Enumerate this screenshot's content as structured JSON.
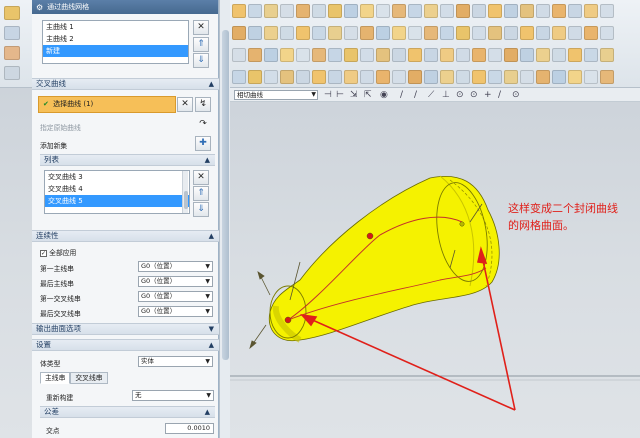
{
  "dialog": {
    "title": "通过曲线网格",
    "primary_curves": {
      "items": [
        "主曲线 1",
        "主曲线 2",
        "新建"
      ],
      "selected_index": 2
    },
    "cross_curves": {
      "header": "交叉曲线",
      "select_label": "选择曲线 (1)",
      "specify_origin": "指定原始曲线",
      "add_new_set": "添加新集",
      "list_header": "列表",
      "items": [
        "交叉曲线 3",
        "交叉曲线 4",
        "交叉曲线 5"
      ],
      "selected_index": 2
    },
    "continuity": {
      "header": "连续性",
      "apply_all": "全部应用",
      "rows": [
        {
          "label": "第一主线串",
          "value": "G0（位置）"
        },
        {
          "label": "最后主线串",
          "value": "G0（位置）"
        },
        {
          "label": "第一交叉线串",
          "value": "G0（位置）"
        },
        {
          "label": "最后交叉线串",
          "value": "G0（位置）"
        }
      ]
    },
    "output_options_header": "输出曲面选项",
    "settings": {
      "header": "设置",
      "body_type_label": "体类型",
      "body_type_value": "实体",
      "tabs": [
        "主线串",
        "交叉线串"
      ],
      "rebuild_label": "重新构建",
      "rebuild_value": "无",
      "tolerance_header": "公差",
      "intersect_label": "交点",
      "intersect_value": "0.0010"
    }
  },
  "selection_bar": {
    "filter_value": "相切曲线"
  },
  "annotation": {
    "text": "这样变成二个封闭曲线的网格曲面。",
    "color": "#e0201a"
  },
  "colors": {
    "surface_yellow": "#f5f200",
    "selected_blue": "#3399ff",
    "highlight_orange": "#f6bf58",
    "title_bar": "#46698f"
  }
}
